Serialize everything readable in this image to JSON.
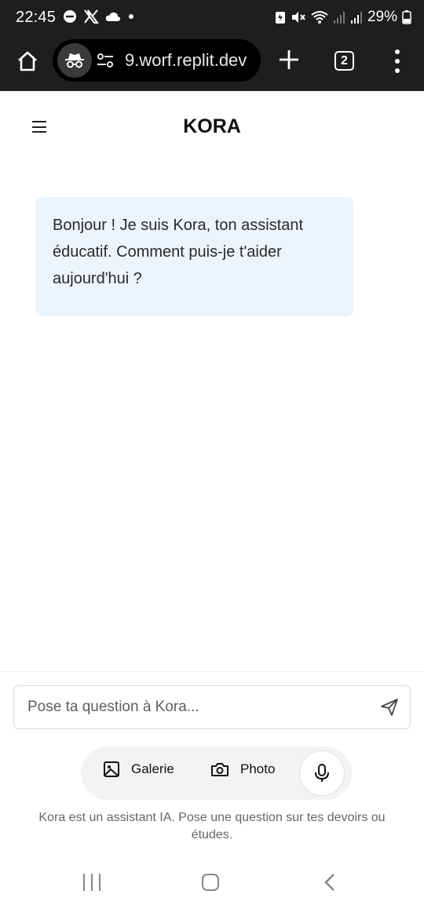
{
  "status_bar": {
    "time": "22:45",
    "battery_percent": "29%",
    "left_icons": [
      "do-not-disturb-icon",
      "x-logo-icon",
      "cloud-icon",
      "dot-icon"
    ],
    "right_icons": [
      "battery-saver-icon",
      "mute-icon",
      "wifi-icon",
      "signal-icon",
      "signal-icon",
      "battery-icon"
    ]
  },
  "browser": {
    "url": "9.worf.replit.dev",
    "tab_count": "2"
  },
  "app": {
    "title": "KORA"
  },
  "chat": {
    "messages": [
      {
        "role": "assistant",
        "text": "Bonjour ! Je suis Kora, ton assistant éducatif. Comment puis-je t'aider aujourd'hui ?"
      }
    ]
  },
  "composer": {
    "placeholder": "Pose ta question à Kora...",
    "value": "",
    "gallery_label": "Galerie",
    "photo_label": "Photo",
    "disclaimer": "Kora est un assistant IA. Pose une question sur tes devoirs ou études."
  },
  "colors": {
    "bubble_bg": "#ecf4fe",
    "bar_bg": "#1e1e1e",
    "pill_bg": "#f1f3f5"
  }
}
